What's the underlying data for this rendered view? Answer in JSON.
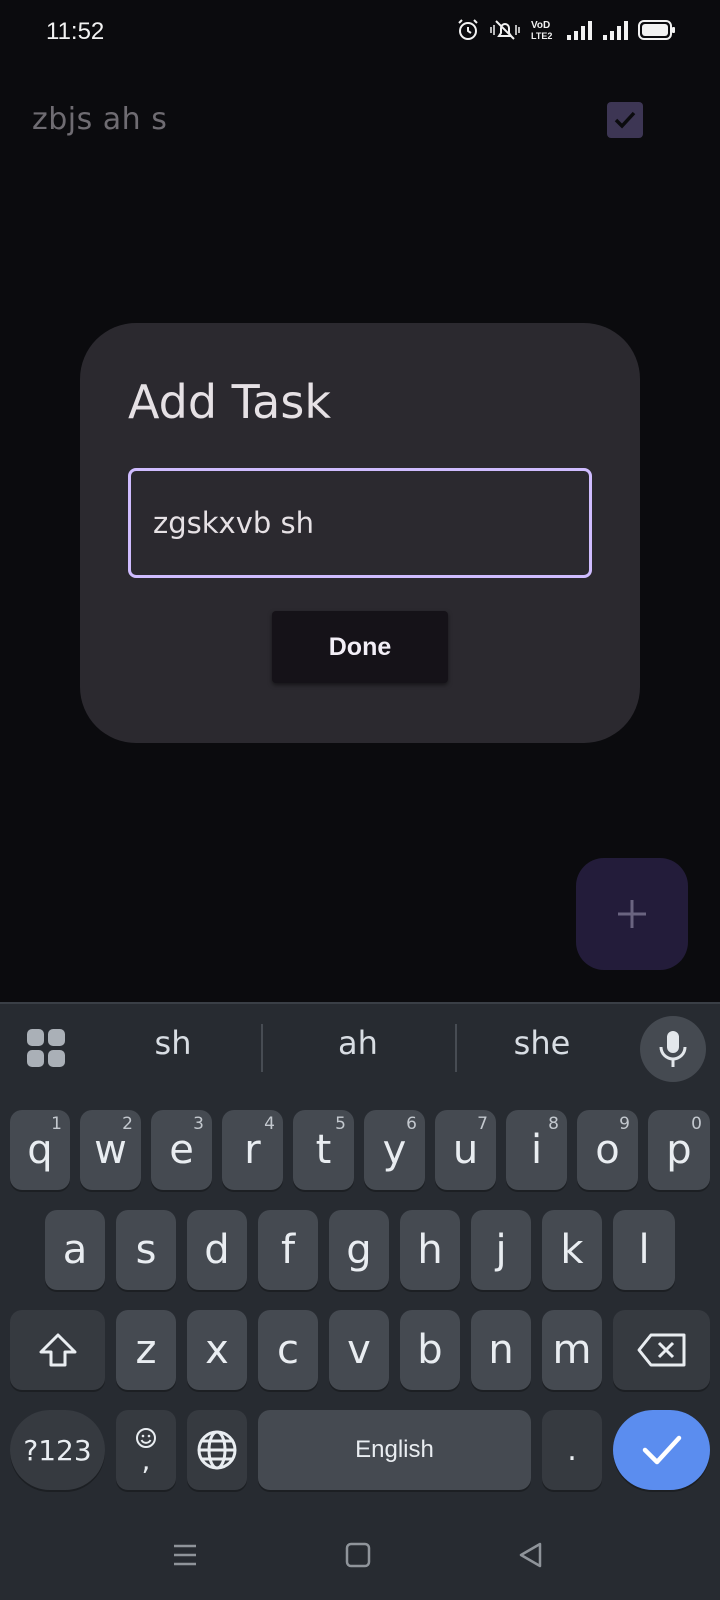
{
  "status_bar": {
    "time": "11:52",
    "icons": [
      "alarm-icon",
      "mute-icon",
      "volte-icon",
      "signal-icon",
      "signal-icon-2",
      "battery-icon"
    ]
  },
  "task_list": {
    "items": [
      {
        "text": "zbjs ah s",
        "checked": true
      }
    ]
  },
  "dialog": {
    "title": "Add Task",
    "input_value": "zgskxvb sh",
    "done_label": "Done"
  },
  "fab": {
    "label": "+",
    "icon": "plus-icon"
  },
  "keyboard": {
    "suggestions": [
      "sh",
      "ah",
      "she"
    ],
    "row1": [
      {
        "k": "q",
        "h": "1"
      },
      {
        "k": "w",
        "h": "2"
      },
      {
        "k": "e",
        "h": "3"
      },
      {
        "k": "r",
        "h": "4"
      },
      {
        "k": "t",
        "h": "5"
      },
      {
        "k": "y",
        "h": "6"
      },
      {
        "k": "u",
        "h": "7"
      },
      {
        "k": "i",
        "h": "8"
      },
      {
        "k": "o",
        "h": "9"
      },
      {
        "k": "p",
        "h": "0"
      }
    ],
    "row2": [
      "a",
      "s",
      "d",
      "f",
      "g",
      "h",
      "j",
      "k",
      "l"
    ],
    "row3": [
      "z",
      "x",
      "c",
      "v",
      "b",
      "n",
      "m"
    ],
    "symbols_label": "?123",
    "comma_label": ",",
    "space_label": "English",
    "period_label": ".",
    "accent_color": "#5b8def"
  },
  "nav_bar": {
    "icons": [
      "recents-icon",
      "home-icon",
      "back-icon"
    ]
  }
}
